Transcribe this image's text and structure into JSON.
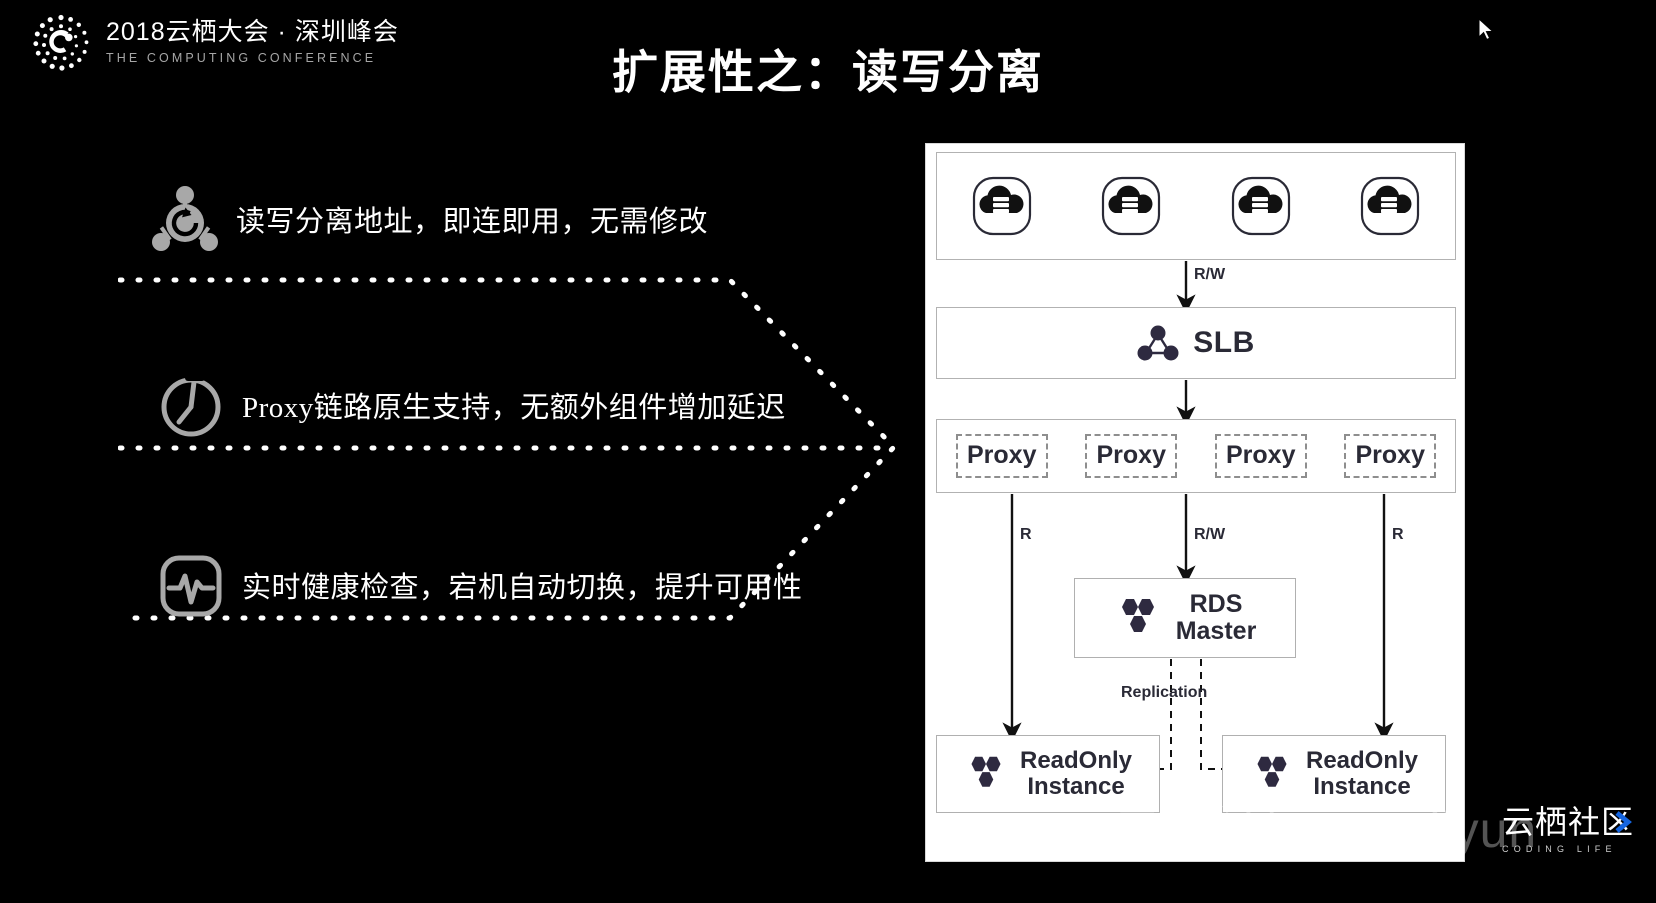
{
  "brand": {
    "logo_icon": "cloud-conference-dot-c-logo",
    "title_cn": "2018云栖大会 · 深圳峰会",
    "title_en": "THE COMPUTING CONFERENCE"
  },
  "slide": {
    "title": "扩展性之：读写分离"
  },
  "bullets": [
    {
      "icon": "rotate-network-node-icon",
      "text": "读写分离地址，即连即用，无需修改"
    },
    {
      "icon": "stopwatch-timer-icon",
      "text": "Proxy链路原生支持，无额外组件增加延迟"
    },
    {
      "icon": "heartbeat-monitor-icon",
      "text": "实时健康检查，宕机自动切换，提升可用性"
    }
  ],
  "diagram": {
    "clients": {
      "icon": "cloud-database-client-icon",
      "count": 4
    },
    "slb": {
      "icon": "slb-triangle-nodes-icon",
      "label": "SLB"
    },
    "proxies": [
      {
        "label": "Proxy"
      },
      {
        "label": "Proxy"
      },
      {
        "label": "Proxy"
      },
      {
        "label": "Proxy"
      }
    ],
    "rds_master": {
      "icon": "rds-hexagon-cluster-icon",
      "line1": "RDS",
      "line2": "Master"
    },
    "readonly_instances": [
      {
        "icon": "rds-hexagon-cluster-icon",
        "line1": "ReadOnly",
        "line2": "Instance"
      },
      {
        "icon": "rds-hexagon-cluster-icon",
        "line1": "ReadOnly",
        "line2": "Instance"
      }
    ],
    "edge_labels": {
      "clients_to_slb": "R/W",
      "proxy_to_readonly_left": "R",
      "proxy_to_master": "R/W",
      "proxy_to_readonly_right": "R",
      "replication": "Replication"
    }
  },
  "watermark": {
    "text": "云栖社区 yq.aliyun",
    "corner_cn": "云栖社区",
    "corner_en": "CODING LIFE",
    "corner_accent": "#1565e0"
  },
  "colors": {
    "background": "#000000",
    "text_primary": "#ffffff",
    "text_muted": "#a6a6a6",
    "icon_gray": "#a8a8a8",
    "panel_bg": "#ffffff",
    "panel_border": "#b2b2b2",
    "diagram_text": "#2a2a36",
    "node_dark": "#2e2a40"
  }
}
